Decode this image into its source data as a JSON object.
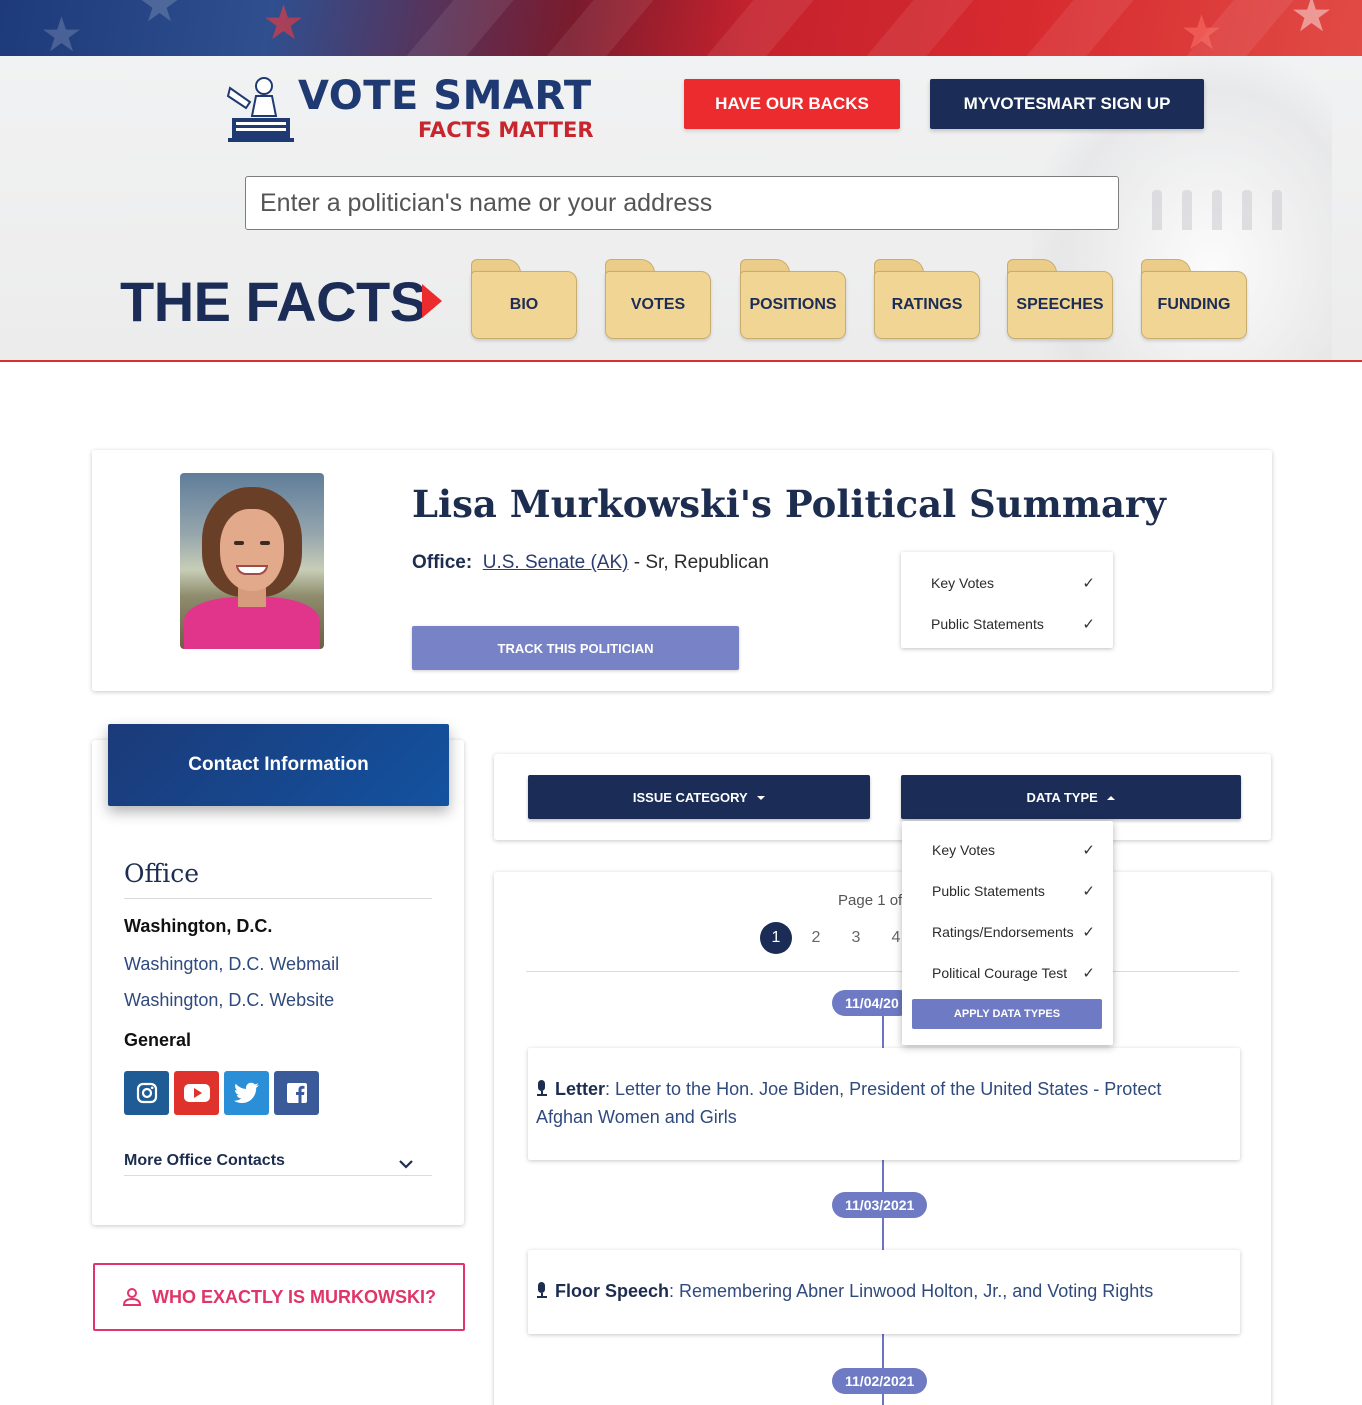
{
  "header": {
    "logo_title": "VOTE SMART",
    "logo_subtitle": "FACTS MATTER",
    "donate_label": "HAVE OUR BACKS",
    "signup_label": "MYVOTESMART SIGN UP",
    "search_placeholder": "Enter a politician's name or your address",
    "facts_title": "THE FACTS",
    "facts_tabs": [
      "BIO",
      "VOTES",
      "POSITIONS",
      "RATINGS",
      "SPEECHES",
      "FUNDING"
    ],
    "colors": {
      "navy": "#1b2c56",
      "red": "#ec2b2e",
      "folder": "#f1d594"
    }
  },
  "summary": {
    "title": "Lisa Murkowski's Political Summary",
    "office_label": "Office:",
    "office_link": "U.S. Senate (AK)",
    "office_detail": " - Sr, Republican",
    "track_label": "TRACK THIS POLITICIAN",
    "data_types": [
      "Key Votes",
      "Public Statements"
    ]
  },
  "contact": {
    "header": "Contact Information",
    "office_heading": "Office",
    "location": "Washington, D.C.",
    "webmail_link": "Washington, D.C. Webmail",
    "website_link": "Washington, D.C. Website",
    "general_heading": "General",
    "social_icons": [
      "instagram-icon",
      "youtube-icon",
      "twitter-icon",
      "facebook-icon"
    ],
    "more_contacts": "More Office Contacts",
    "who_button": "WHO EXACTLY IS MURKOWSKI?"
  },
  "filters": {
    "issue_category": "ISSUE CATEGORY",
    "data_type": "DATA TYPE"
  },
  "data_type_dropdown": {
    "options": [
      "Key Votes",
      "Public Statements",
      "Ratings/Endorsements",
      "Political Courage Test"
    ],
    "apply_label": "APPLY DATA TYPES"
  },
  "timeline": {
    "page_label": "Page 1 of",
    "pages": [
      "1",
      "2",
      "3",
      "4"
    ],
    "current_page": "1",
    "entries": [
      {
        "date": "11/04/20",
        "type": "Letter",
        "text": ": Letter to the Hon. Joe Biden, President of the United States - Protect Afghan Women and Girls"
      },
      {
        "date": "11/03/2021",
        "type": "Floor Speech",
        "text": ": Remembering Abner Linwood Holton, Jr., and Voting Rights"
      },
      {
        "date": "11/02/2021"
      }
    ],
    "accent": "#6e7ac4"
  }
}
